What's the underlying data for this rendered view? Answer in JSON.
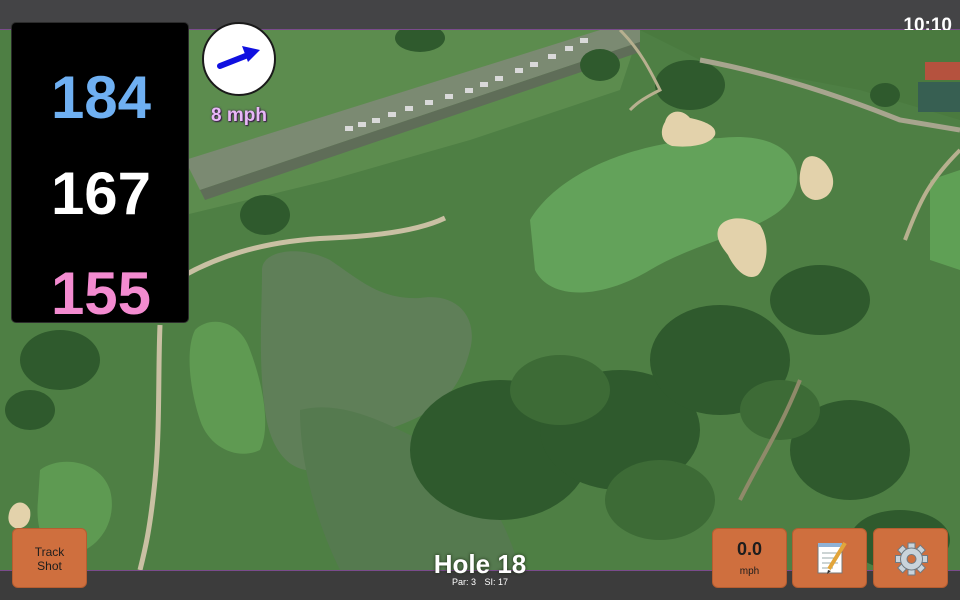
{
  "status": {
    "clock": "10:10"
  },
  "distances": {
    "back": "184",
    "middle": "167",
    "front": "155"
  },
  "wind": {
    "speed_label": "8 mph",
    "direction_icon": "arrow-up-right-icon"
  },
  "hole": {
    "title": "Hole 18",
    "par_label": "Par: 3",
    "si_label": "SI: 17"
  },
  "buttons": {
    "track_shot_line1": "Track",
    "track_shot_line2": "Shot",
    "speed_value": "0.0",
    "speed_unit": "mph",
    "notes_icon": "notepad-icon",
    "settings_icon": "gear-icon"
  },
  "colors": {
    "back_distance": "#6fb0f2",
    "middle_distance": "#ffffff",
    "front_distance": "#f38bd0",
    "wind_arrow": "#1010e0",
    "button_orange": "#cf6f3e"
  }
}
